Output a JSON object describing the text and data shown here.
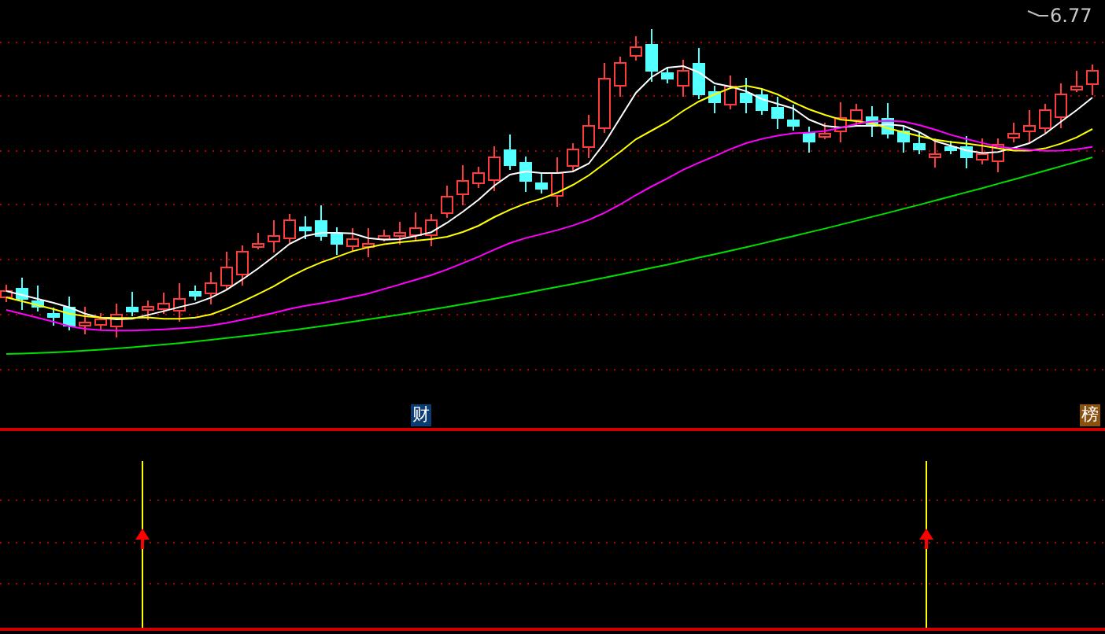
{
  "price_chart": {
    "high_label": "6.77",
    "badges": [
      {
        "label": "财",
        "kind": "finance"
      },
      {
        "label": "榜",
        "kind": "ranking"
      }
    ]
  }
}
